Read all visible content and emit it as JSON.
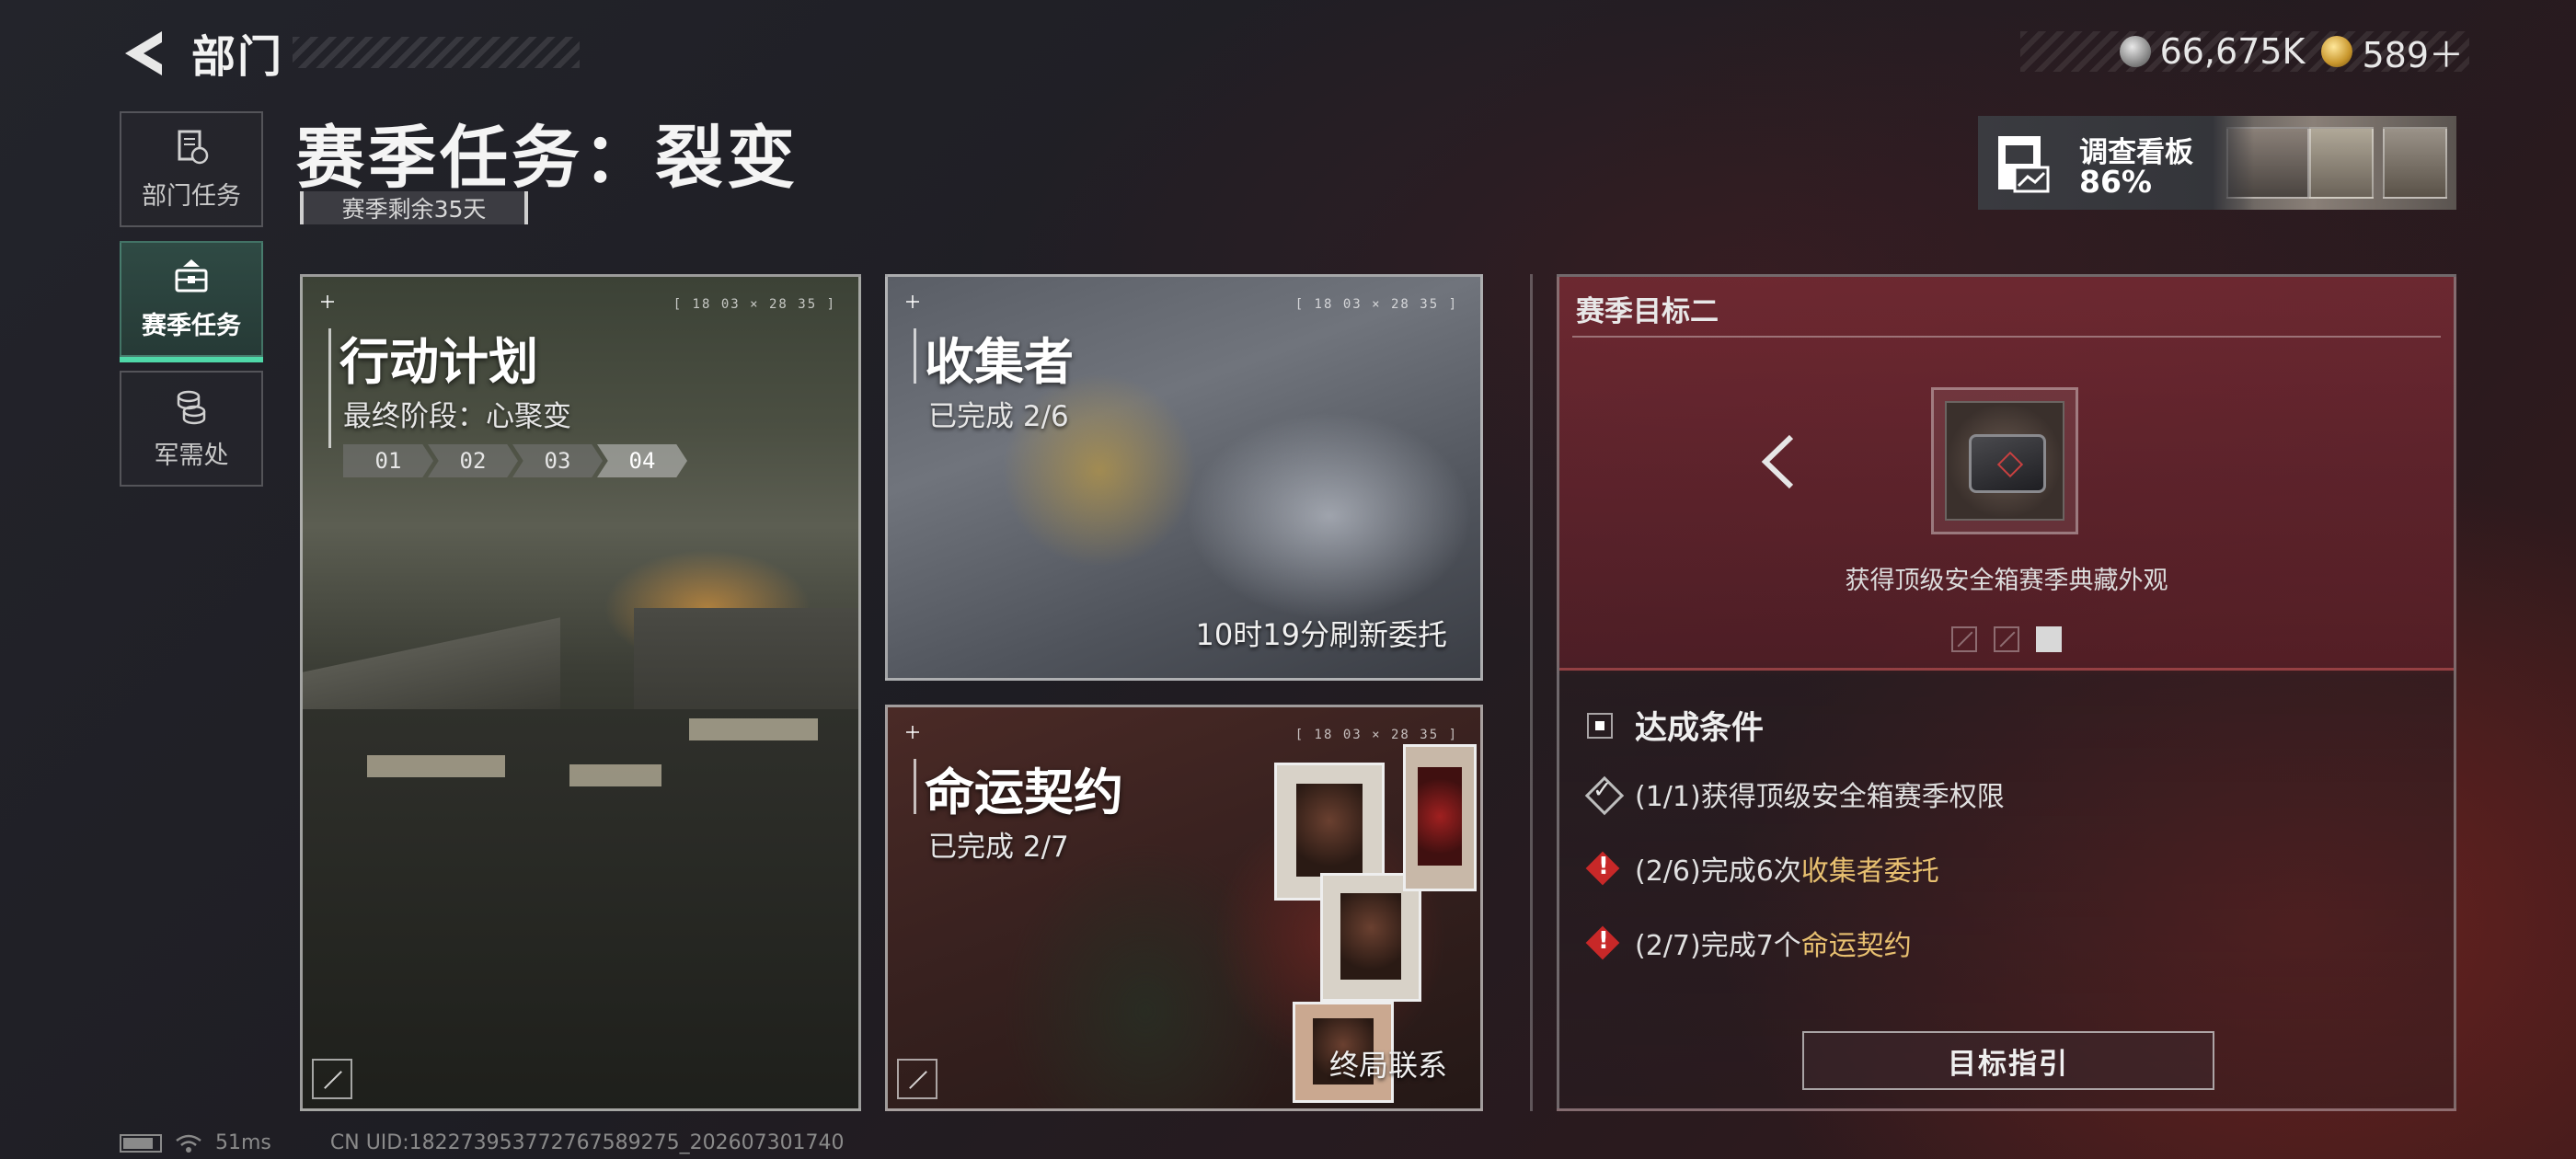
{
  "header": {
    "title": "部门",
    "currencies": [
      {
        "icon": "silver-coin-icon",
        "value": "66,675K"
      },
      {
        "icon": "gold-coin-icon",
        "value": "589＋"
      }
    ]
  },
  "sidebar": {
    "items": [
      {
        "label": "部门任务",
        "icon": "document-icon",
        "active": false
      },
      {
        "label": "赛季任务",
        "icon": "briefcase-icon",
        "active": true
      },
      {
        "label": "军需处",
        "icon": "coins-icon",
        "active": false
      }
    ]
  },
  "page": {
    "title": "赛季任务：裂变",
    "remaining": "赛季剩余35天"
  },
  "board": {
    "title": "调查看板",
    "percent": "86%"
  },
  "cards": {
    "ops": {
      "title": "行动计划",
      "subtitle": "最终阶段：心聚变",
      "code": "[ 18 03 × 28 35 ]",
      "stages": [
        "01",
        "02",
        "03",
        "04"
      ],
      "current_stage": "04"
    },
    "collector": {
      "title": "收集者",
      "subtitle": "已完成 2/6",
      "code": "[ 18 03 × 28 35 ]",
      "bottom": "10时19分刷新委托"
    },
    "fate": {
      "title": "命运契约",
      "subtitle": "已完成 2/7",
      "code": "[ 18 03 × 28 35 ]",
      "bottom": "终局联系"
    }
  },
  "goal": {
    "title": "赛季目标二",
    "reward_desc": "获得顶级安全箱赛季典藏外观",
    "pages": 3,
    "current_page": 3,
    "conditions_title": "达成条件",
    "conditions": [
      {
        "status": "done",
        "prefix": "(1/1)获得顶级安全箱赛季权限",
        "highlight": ""
      },
      {
        "status": "pending",
        "prefix": "(2/6)完成6次",
        "highlight": "收集者委托"
      },
      {
        "status": "pending",
        "prefix": "(2/7)完成7个",
        "highlight": "命运契约"
      }
    ],
    "guide_button": "目标指引"
  },
  "footer": {
    "ping": "51ms",
    "uid": "CN UID:182273953772767589275_202607301740"
  },
  "colors": {
    "accent_green": "#4fd8a8",
    "highlight_gold": "#e8c070",
    "warn_red": "#c82828"
  }
}
